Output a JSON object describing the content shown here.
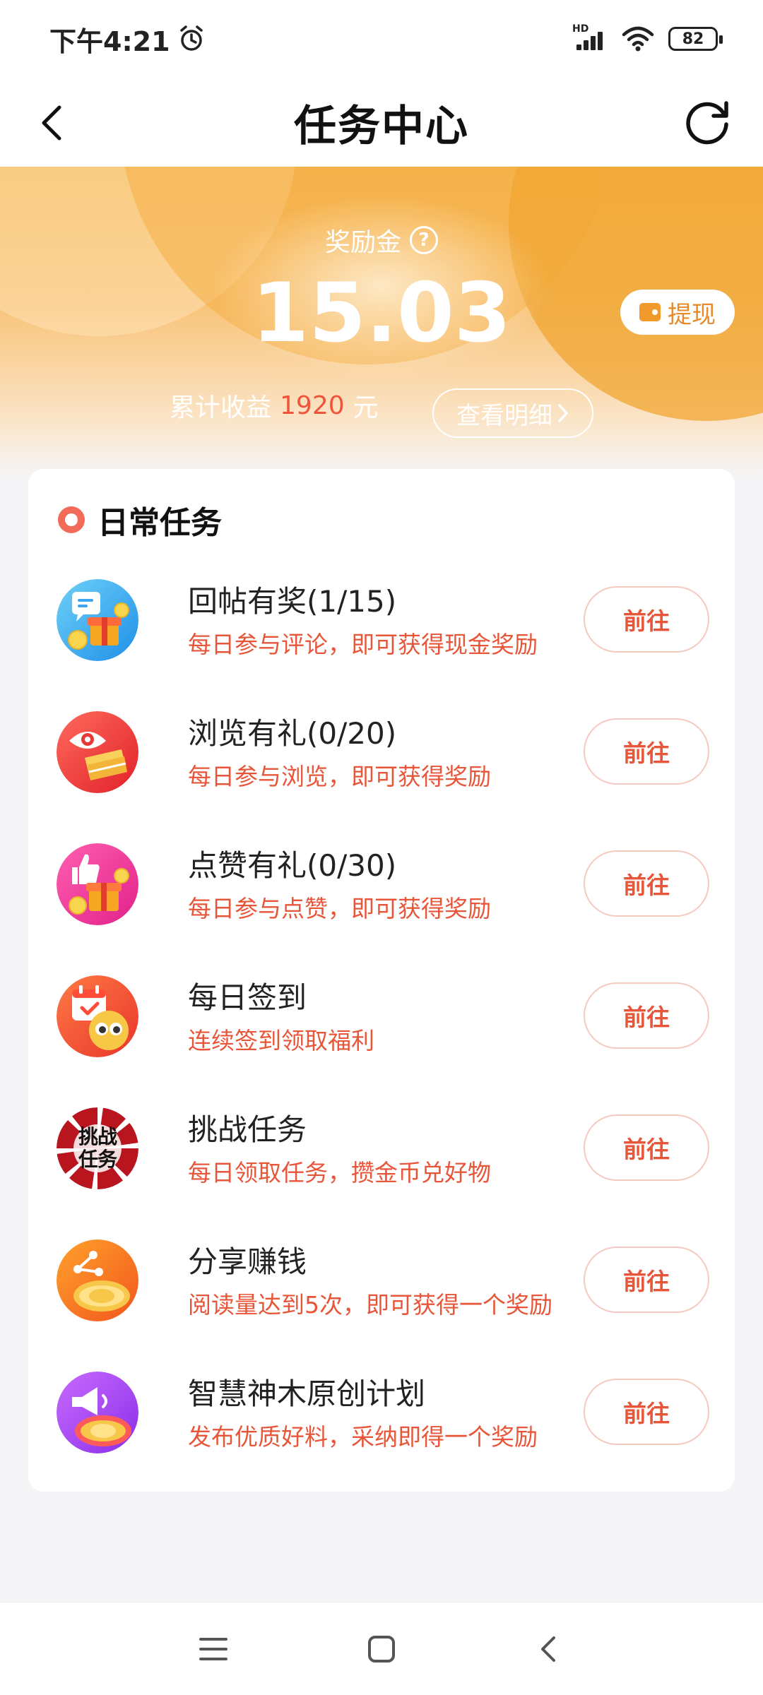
{
  "status_bar": {
    "time": "下午4:21",
    "network": "HD",
    "battery": "82"
  },
  "header": {
    "title": "任务中心"
  },
  "wallet": {
    "reward_label": "奖励金",
    "reward_amount": "15.03",
    "withdraw_label": "提现",
    "earnings_prefix": "累计收益",
    "earnings_value": "1920",
    "earnings_unit": "元",
    "detail_label": "查看明细"
  },
  "daily_tasks": {
    "title": "日常任务",
    "go_label": "前往",
    "items": [
      {
        "name": "回帖有奖(1/15)",
        "desc": "每日参与评论，即可获得现金奖励",
        "icon": "comment-gift-icon"
      },
      {
        "name": "浏览有礼(0/20)",
        "desc": "每日参与浏览，即可获得奖励",
        "icon": "browse-eye-icon"
      },
      {
        "name": "点赞有礼(0/30)",
        "desc": "每日参与点赞，即可获得奖励",
        "icon": "thumbs-up-gift-icon"
      },
      {
        "name": "每日签到",
        "desc": "连续签到领取福利",
        "icon": "calendar-checkin-icon"
      },
      {
        "name": "挑战任务",
        "desc": "每日领取任务，攒金币兑好物",
        "icon": "challenge-badge-icon",
        "icon_text": "挑战任务"
      },
      {
        "name": "分享赚钱",
        "desc": "阅读量达到5次，即可获得一个奖励",
        "icon": "share-coin-icon"
      },
      {
        "name": "智慧神木原创计划",
        "desc": "发布优质好料，采纳即得一个奖励",
        "icon": "megaphone-coin-icon"
      }
    ]
  },
  "colors": {
    "accent": "#e8563a",
    "hero_orange": "#f5b650",
    "withdraw_text": "#e8892a"
  }
}
